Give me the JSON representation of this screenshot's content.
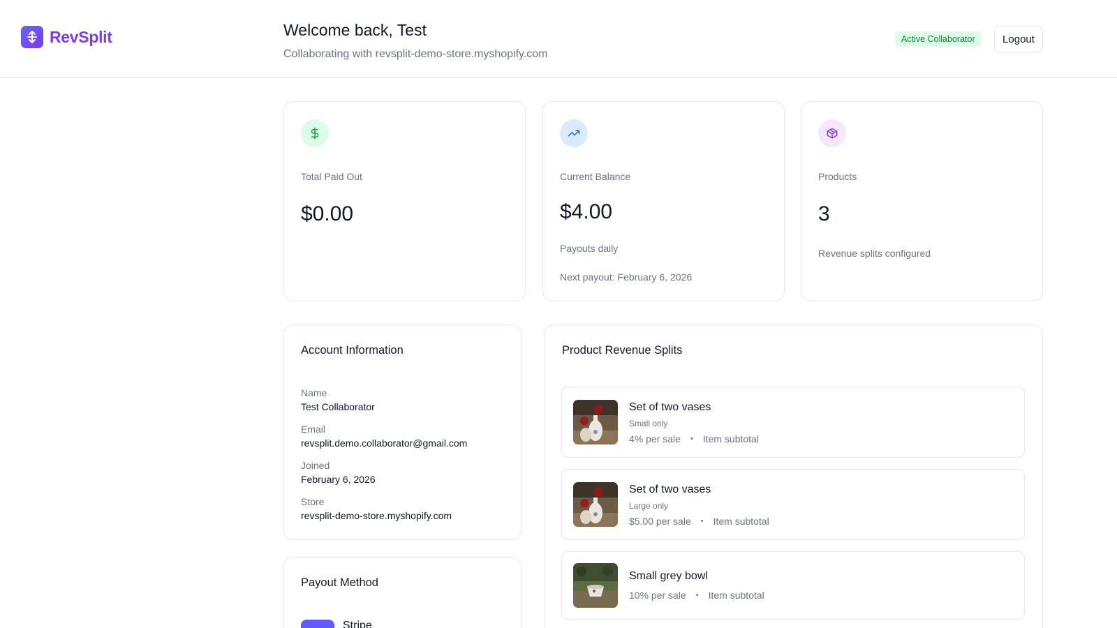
{
  "brand": {
    "name": "RevSplit",
    "accent": "#7c3aed"
  },
  "header": {
    "welcome": "Welcome back, Test",
    "subtitle": "Collaborating with revsplit-demo-store.myshopify.com",
    "badge": "Active Collaborator",
    "logout_label": "Logout"
  },
  "stats": {
    "total_paid": {
      "icon": "dollar-icon",
      "label": "Total Paid Out",
      "value": "$0.00"
    },
    "balance": {
      "icon": "trending-up-icon",
      "label": "Current Balance",
      "value": "$4.00",
      "sub1": "Payouts daily",
      "sub2": "Next payout: February 6, 2026"
    },
    "products": {
      "icon": "package-icon",
      "label": "Products",
      "value": "3",
      "sub1": "Revenue splits configured"
    }
  },
  "account": {
    "title": "Account Information",
    "fields": [
      {
        "label": "Name",
        "value": "Test Collaborator"
      },
      {
        "label": "Email",
        "value": "revsplit.demo.collaborator@gmail.com"
      },
      {
        "label": "Joined",
        "value": "February 6, 2026"
      },
      {
        "label": "Store",
        "value": "revsplit-demo-store.myshopify.com"
      }
    ]
  },
  "payout": {
    "title": "Payout Method",
    "provider": "Stripe"
  },
  "splits": {
    "title": "Product Revenue Splits",
    "items": [
      {
        "name": "Set of two vases",
        "variant": "Small only",
        "rate": "4% per sale",
        "basis": "Item subtotal"
      },
      {
        "name": "Set of two vases",
        "variant": "Large only",
        "rate": "$5.00 per sale",
        "basis": "Item subtotal"
      },
      {
        "name": "Small grey bowl",
        "variant": "",
        "rate": "10% per sale",
        "basis": "Item subtotal"
      }
    ]
  }
}
